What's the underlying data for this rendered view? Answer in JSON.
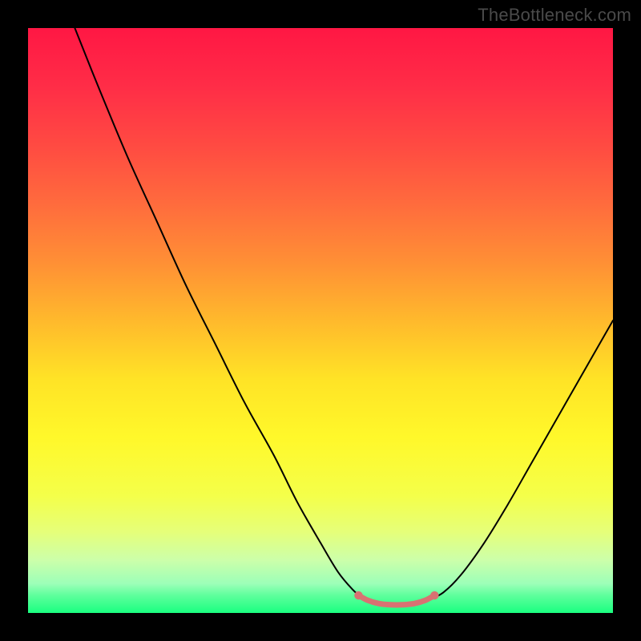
{
  "watermark": "TheBottleneck.com",
  "chart_data": {
    "type": "line",
    "title": "",
    "xlabel": "",
    "ylabel": "",
    "xlim": [
      0,
      100
    ],
    "ylim": [
      0,
      100
    ],
    "gradient_stops": [
      {
        "offset": 0,
        "color": "#ff1744"
      },
      {
        "offset": 10,
        "color": "#ff2d47"
      },
      {
        "offset": 20,
        "color": "#ff4a42"
      },
      {
        "offset": 30,
        "color": "#ff6b3d"
      },
      {
        "offset": 40,
        "color": "#ff8f35"
      },
      {
        "offset": 50,
        "color": "#ffb92c"
      },
      {
        "offset": 60,
        "color": "#ffe326"
      },
      {
        "offset": 70,
        "color": "#fff82a"
      },
      {
        "offset": 80,
        "color": "#f4ff4a"
      },
      {
        "offset": 86,
        "color": "#e6ff78"
      },
      {
        "offset": 91,
        "color": "#ccffaa"
      },
      {
        "offset": 95,
        "color": "#9cffb8"
      },
      {
        "offset": 97,
        "color": "#5eff9c"
      },
      {
        "offset": 100,
        "color": "#1aff80"
      }
    ],
    "series": [
      {
        "name": "bottleneck-curve-left",
        "type": "curve",
        "stroke": "#000000",
        "stroke_width": 2,
        "points": [
          {
            "x": 8.0,
            "y": 100.0
          },
          {
            "x": 12.0,
            "y": 90.0
          },
          {
            "x": 17.0,
            "y": 78.0
          },
          {
            "x": 22.0,
            "y": 67.0
          },
          {
            "x": 27.0,
            "y": 56.0
          },
          {
            "x": 32.0,
            "y": 46.0
          },
          {
            "x": 37.0,
            "y": 36.0
          },
          {
            "x": 42.0,
            "y": 27.0
          },
          {
            "x": 46.0,
            "y": 19.0
          },
          {
            "x": 50.0,
            "y": 12.0
          },
          {
            "x": 53.0,
            "y": 7.0
          },
          {
            "x": 55.5,
            "y": 4.0
          },
          {
            "x": 57.5,
            "y": 2.2
          }
        ]
      },
      {
        "name": "bottleneck-curve-right",
        "type": "curve",
        "stroke": "#000000",
        "stroke_width": 2,
        "points": [
          {
            "x": 68.5,
            "y": 2.2
          },
          {
            "x": 71.0,
            "y": 3.5
          },
          {
            "x": 74.0,
            "y": 6.5
          },
          {
            "x": 78.0,
            "y": 12.0
          },
          {
            "x": 82.0,
            "y": 18.5
          },
          {
            "x": 86.0,
            "y": 25.5
          },
          {
            "x": 90.0,
            "y": 32.5
          },
          {
            "x": 94.0,
            "y": 39.5
          },
          {
            "x": 98.0,
            "y": 46.5
          },
          {
            "x": 100.0,
            "y": 50.0
          }
        ]
      },
      {
        "name": "optimal-band",
        "type": "band",
        "stroke": "#d87272",
        "stroke_width": 7,
        "points": [
          {
            "x": 56.5,
            "y": 3.0
          },
          {
            "x": 58.0,
            "y": 2.2
          },
          {
            "x": 60.0,
            "y": 1.6
          },
          {
            "x": 62.0,
            "y": 1.4
          },
          {
            "x": 64.0,
            "y": 1.4
          },
          {
            "x": 66.0,
            "y": 1.6
          },
          {
            "x": 68.0,
            "y": 2.2
          },
          {
            "x": 69.5,
            "y": 3.0
          }
        ]
      }
    ]
  }
}
